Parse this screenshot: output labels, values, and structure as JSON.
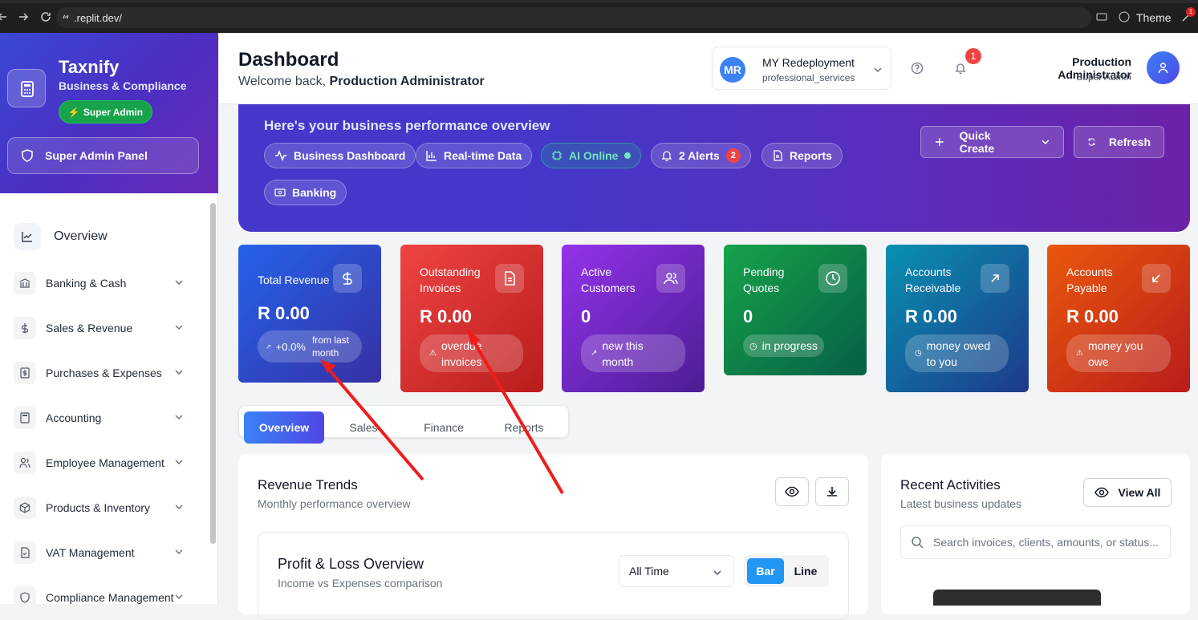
{
  "browser": {
    "url": ".replit.dev/",
    "theme_label": "Theme",
    "ext_badge": "1"
  },
  "sidebar": {
    "brand": "Taxnify",
    "brand_sub": "Business & Compliance",
    "role_pill": "Super Admin",
    "admin_panel": "Super Admin Panel",
    "overview": "Overview",
    "items": [
      {
        "label": "Banking & Cash",
        "icon": "bank-icon"
      },
      {
        "label": "Sales & Revenue",
        "icon": "dollar-icon"
      },
      {
        "label": "Purchases & Expenses",
        "icon": "receipt-icon"
      },
      {
        "label": "Accounting",
        "icon": "calculator-icon"
      },
      {
        "label": "Employee Management",
        "icon": "users-icon"
      },
      {
        "label": "Products & Inventory",
        "icon": "package-icon"
      },
      {
        "label": "VAT Management",
        "icon": "file-check-icon"
      },
      {
        "label": "Compliance Management",
        "icon": "shield-icon"
      }
    ]
  },
  "header": {
    "title": "Dashboard",
    "welcome_prefix": "Welcome back,",
    "welcome_name": "Production Administrator",
    "org_initials": "MR",
    "org_name": "MY Redeployment",
    "org_type": "professional_services",
    "notif_count": "1",
    "user_name": "Production Administrator",
    "user_role": "Super Admin"
  },
  "hero": {
    "subtitle": "Here's your business performance overview",
    "chips": [
      "Business Dashboard",
      "Real-time Data",
      "AI Online",
      "2 Alerts",
      "Reports",
      "Banking"
    ],
    "alerts_badge": "2",
    "quick_create": "Quick Create",
    "refresh": "Refresh"
  },
  "cards": [
    {
      "title": "Total Revenue",
      "value": "R 0.00",
      "pill_a": "+0.0%",
      "pill_b": "from last month",
      "color_from": "#2563eb",
      "color_to": "#3730a3"
    },
    {
      "title": "Outstanding Invoices",
      "value": "R 0.00",
      "pill": "overdue invoices",
      "color_from": "#ef4444",
      "color_to": "#b91c1c"
    },
    {
      "title": "Active Customers",
      "value": "0",
      "pill": "new this month",
      "color_from": "#9333ea",
      "color_to": "#4c1d95"
    },
    {
      "title": "Pending Quotes",
      "value": "0",
      "pill": "in progress",
      "color_from": "#16a34a",
      "color_to": "#065f46"
    },
    {
      "title": "Accounts Receivable",
      "value": "R 0.00",
      "pill": "money owed to you",
      "color_from": "#0891b2",
      "color_to": "#1e3a8a"
    },
    {
      "title": "Accounts Payable",
      "value": "R 0.00",
      "pill": "money you owe",
      "color_from": "#ea580c",
      "color_to": "#b91c1c"
    }
  ],
  "tabs": [
    "Overview",
    "Sales",
    "Finance",
    "Reports"
  ],
  "revenue": {
    "title": "Revenue Trends",
    "subtitle": "Monthly performance overview",
    "pl_title": "Profit & Loss Overview",
    "pl_subtitle": "Income vs Expenses comparison",
    "period": "All Time",
    "toggle_bar": "Bar",
    "toggle_line": "Line"
  },
  "activities": {
    "title": "Recent Activities",
    "subtitle": "Latest business updates",
    "view_all": "View All",
    "search_placeholder": "Search invoices, clients, amounts, or status..."
  }
}
